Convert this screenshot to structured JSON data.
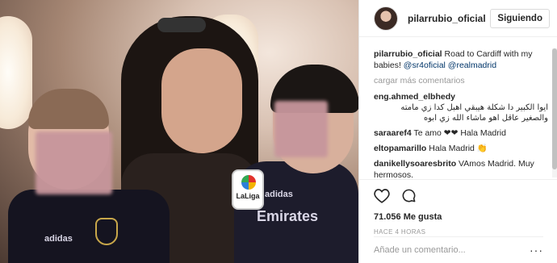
{
  "post": {
    "username": "pilarrubio_oficial",
    "follow_label": "Siguiendo",
    "caption": {
      "user": "pilarrubio_oficial",
      "text": "Road to Cardiff with my babies!",
      "mention1": "@sr4oficial",
      "mention2": "@realmadrid"
    },
    "load_more": "cargar más comentarios",
    "comments": [
      {
        "user": "eng.ahmed_elbhedy",
        "text": "ايوا الكبير دا شكلة هيبقي اهبل كدا زي مامته والصغير عاقل اهو ماشاء الله زي ابوه",
        "rtl": true
      },
      {
        "user": "saraaref4",
        "text": "Te amo ❤❤ Hala Madrid"
      },
      {
        "user": "eltopamarillo",
        "text": "Hala Madrid 👏"
      },
      {
        "user": "danikellysoaresbrito",
        "text": "VAmos Madrid. Muy hermosos."
      }
    ],
    "likes": "71.056 Me gusta",
    "time": "HACE 4 HORAS",
    "comment_placeholder": "Añade un comentario...",
    "options": "···"
  },
  "photo": {
    "laliga_label": "LaLiga",
    "shirt_texts": [
      "adidas",
      "adidas",
      "Emirates"
    ]
  },
  "icons": [
    "heart-icon",
    "comment-icon"
  ]
}
